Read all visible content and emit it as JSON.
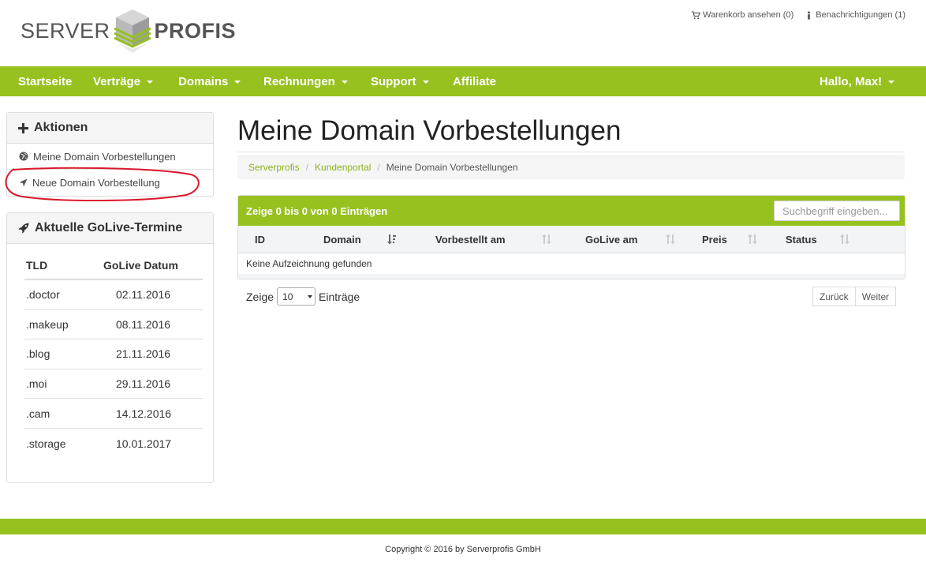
{
  "logo": {
    "left_text": "SERVER",
    "right_text": "PROFIS"
  },
  "top_links": {
    "cart": "Warenkorb ansehen (0)",
    "notifications": "Benachrichtigungen (1)"
  },
  "nav": {
    "items": [
      {
        "label": "Startseite",
        "dropdown": false
      },
      {
        "label": "Verträge",
        "dropdown": true
      },
      {
        "label": "Domains",
        "dropdown": true
      },
      {
        "label": "Rechnungen",
        "dropdown": true
      },
      {
        "label": "Support",
        "dropdown": true
      },
      {
        "label": "Affiliate",
        "dropdown": false
      }
    ],
    "user": "Hallo, Max!"
  },
  "sidebar": {
    "actions": {
      "title": "Aktionen",
      "items": [
        {
          "label": "Meine Domain Vorbestellungen",
          "icon": "globe-icon"
        },
        {
          "label": "Neue Domain Vorbestellung",
          "icon": "location-arrow-icon"
        }
      ]
    },
    "golive": {
      "title": "Aktuelle GoLive-Termine",
      "columns": [
        "TLD",
        "GoLive Datum"
      ],
      "rows": [
        {
          "tld": ".doctor",
          "date": "02.11.2016"
        },
        {
          "tld": ".makeup",
          "date": "08.11.2016"
        },
        {
          "tld": ".blog",
          "date": "21.11.2016"
        },
        {
          "tld": ".moi",
          "date": "29.11.2016"
        },
        {
          "tld": ".cam",
          "date": "14.12.2016"
        },
        {
          "tld": ".storage",
          "date": "10.01.2017"
        }
      ]
    }
  },
  "main": {
    "title": "Meine Domain Vorbestellungen",
    "breadcrumb": [
      "Serverprofis",
      "Kundenportal",
      "Meine Domain Vorbestellungen"
    ],
    "table": {
      "info": "Zeige 0 bis 0 von 0 Einträgen",
      "search_placeholder": "Suchbegriff eingeben...",
      "columns": [
        "ID",
        "Domain",
        "Vorbestellt am",
        "GoLive am",
        "Preis",
        "Status"
      ],
      "empty": "Keine Aufzeichnung gefunden"
    },
    "length": {
      "prefix": "Zeige",
      "value": "10",
      "suffix": "Einträge"
    },
    "pager": {
      "prev": "Zurück",
      "next": "Weiter"
    }
  },
  "footer": {
    "copyright": "Copyright © 2016 by Serverprofis GmbH"
  },
  "colors": {
    "brand_green": "#96c11f",
    "link_green": "#8cb21d",
    "annotation_red": "#d9182a"
  }
}
